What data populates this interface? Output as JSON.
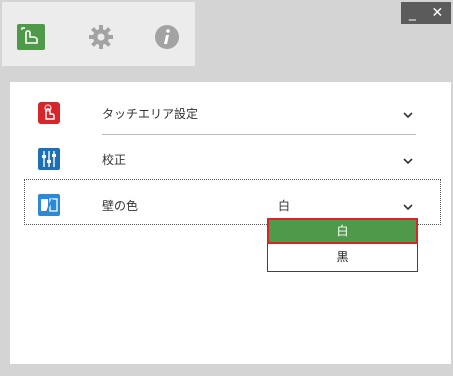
{
  "window": {
    "controls": {
      "minimize": "_",
      "close": "✕"
    }
  },
  "toolbar": {
    "icons": [
      {
        "name": "touch-settings-icon",
        "color": "#4e9a4a"
      },
      {
        "name": "gear-icon",
        "color": "#9e9e9e"
      },
      {
        "name": "info-icon",
        "color": "#9e9e9e"
      }
    ]
  },
  "settings": {
    "rows": [
      {
        "label": "タッチエリア設定",
        "value": "",
        "icon": "touch-area-icon",
        "icon_color": "#d6262a"
      },
      {
        "label": "校正",
        "value": "",
        "icon": "calibration-icon",
        "icon_color": "#1f6fb5"
      },
      {
        "label": "壁の色",
        "value": "白",
        "icon": "wall-color-icon",
        "icon_color": "#2a8ad8"
      }
    ]
  },
  "dropdown": {
    "options": [
      "白",
      "黒"
    ],
    "selected_index": 0
  },
  "colors": {
    "accent_green": "#4e9a4a",
    "highlight_red": "#d6262a"
  }
}
